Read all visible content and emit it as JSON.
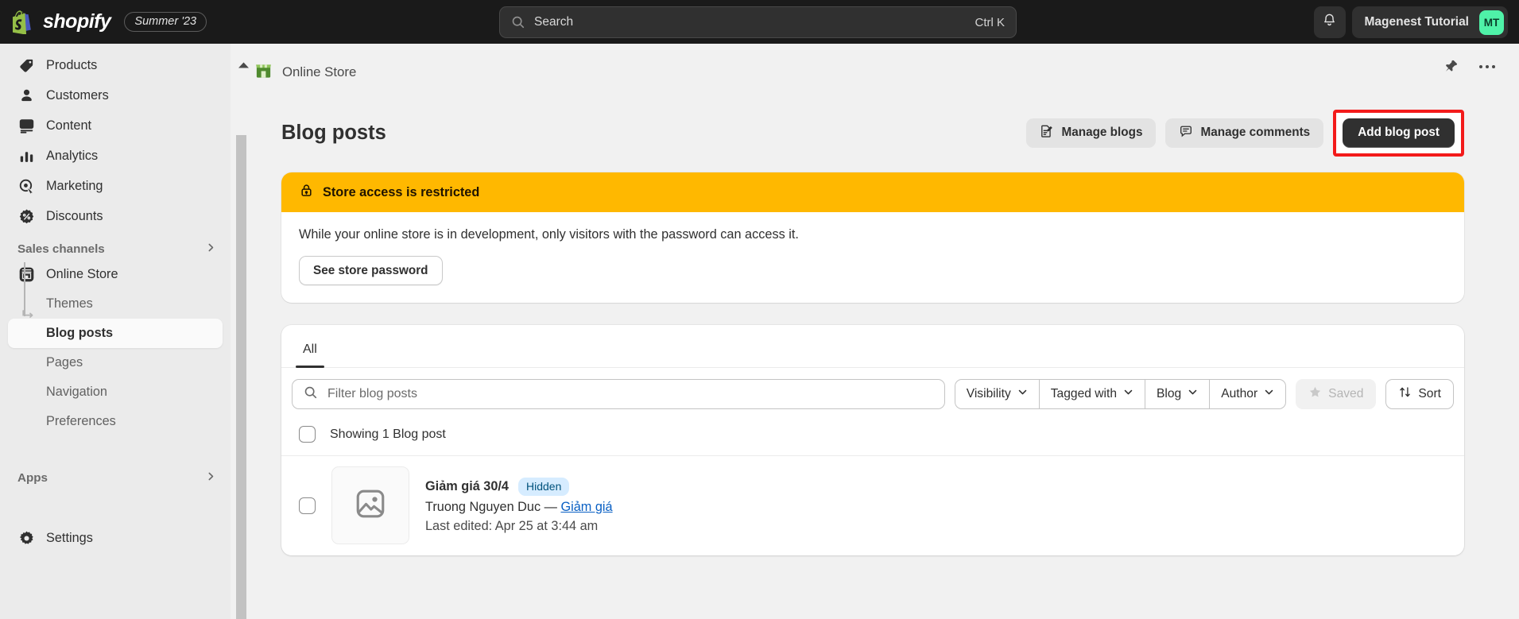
{
  "topbar": {
    "brand_name": "shopify",
    "season_badge": "Summer '23",
    "search": {
      "placeholder": "Search",
      "shortcut": "Ctrl K",
      "icon": "search-icon"
    },
    "notifications_icon": "bell-icon",
    "account_name": "Magenest Tutorial",
    "account_initials": "MT",
    "accent_avatar_color": "#4ff2a8",
    "background_color": "#1a1a1a"
  },
  "sidebar": {
    "items": [
      {
        "label": "Products",
        "icon": "tag-icon"
      },
      {
        "label": "Customers",
        "icon": "person-icon"
      },
      {
        "label": "Content",
        "icon": "content-image-icon"
      },
      {
        "label": "Analytics",
        "icon": "bar-chart-icon"
      },
      {
        "label": "Marketing",
        "icon": "marketing-target-icon"
      },
      {
        "label": "Discounts",
        "icon": "discount-badge-icon"
      }
    ],
    "sections": [
      {
        "label": "Sales channels",
        "chevron": "chevron-right-icon",
        "channel": {
          "label": "Online Store",
          "icon": "storefront-icon"
        },
        "children": [
          {
            "label": "Themes",
            "active": false
          },
          {
            "label": "Blog posts",
            "active": true
          },
          {
            "label": "Pages",
            "active": false
          },
          {
            "label": "Navigation",
            "active": false
          },
          {
            "label": "Preferences",
            "active": false
          }
        ]
      },
      {
        "label": "Apps",
        "chevron": "chevron-right-icon",
        "children": []
      }
    ],
    "settings": {
      "label": "Settings",
      "icon": "gear-icon"
    },
    "background_color": "#ebebeb"
  },
  "context_bar": {
    "collapse_icon": "caret-up-icon",
    "store_icon": "green-storefront-icon",
    "title": "Online Store",
    "pin_icon": "pin-icon",
    "more_icon": "ellipsis-horizontal-icon"
  },
  "page": {
    "title": "Blog posts",
    "actions": [
      {
        "label": "Manage blogs",
        "icon": "edit-document-icon",
        "style": "secondary",
        "highlighted": false
      },
      {
        "label": "Manage comments",
        "icon": "chat-bubble-icon",
        "style": "secondary",
        "highlighted": false
      },
      {
        "label": "Add blog post",
        "icon": "",
        "style": "primary",
        "highlighted": true
      }
    ],
    "highlight_color": "#f31b1b"
  },
  "banner": {
    "icon": "lock-icon",
    "title": "Store access is restricted",
    "body": "While your online store is in development, only visitors with the password can access it.",
    "button_label": "See store password",
    "header_color": "#ffb800"
  },
  "list_card": {
    "tabs": [
      {
        "label": "All",
        "active": true
      }
    ],
    "search": {
      "placeholder": "Filter blog posts",
      "icon": "search-icon"
    },
    "filters": [
      {
        "label": "Visibility",
        "icon": "chevron-down-icon"
      },
      {
        "label": "Tagged with",
        "icon": "chevron-down-icon"
      },
      {
        "label": "Blog",
        "icon": "chevron-down-icon"
      },
      {
        "label": "Author",
        "icon": "chevron-down-icon"
      }
    ],
    "saved_button": {
      "label": "Saved",
      "icon": "star-icon",
      "disabled": true
    },
    "sort_button": {
      "label": "Sort",
      "icon": "sort-arrows-icon"
    },
    "showing_label": "Showing 1 Blog post",
    "rows": [
      {
        "title": "Giảm giá 30/4",
        "status": "Hidden",
        "author": "Truong Nguyen Duc",
        "separator": "—",
        "blog_link": "Giảm giá",
        "last_edited": "Last edited: Apr 25 at 3:44 am",
        "thumb_icon": "image-placeholder-icon"
      }
    ]
  }
}
